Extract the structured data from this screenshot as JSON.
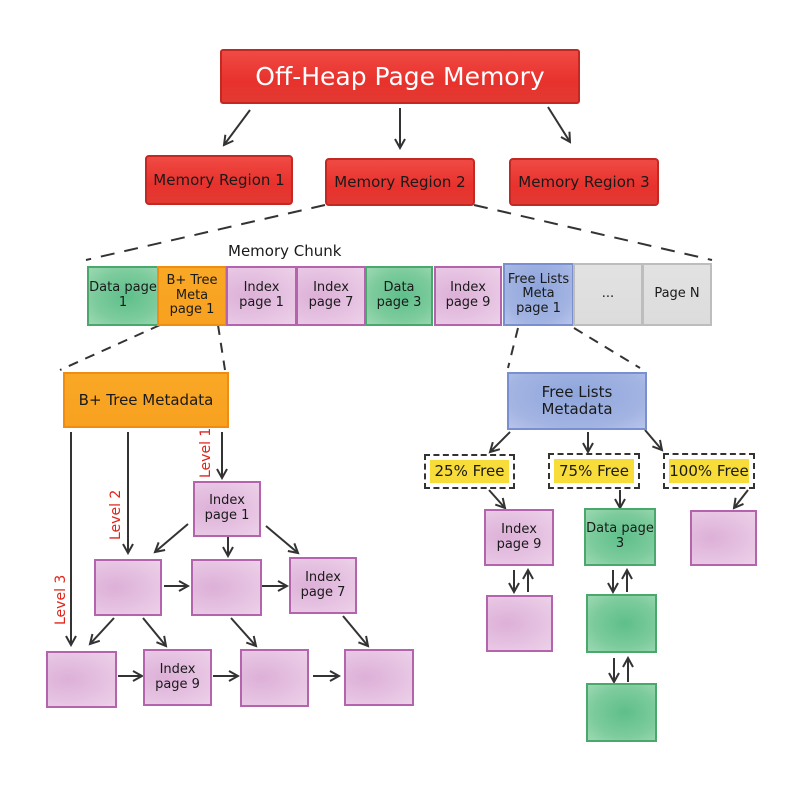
{
  "title": "Off-Heap Page Memory",
  "regions": [
    "Memory Region 1",
    "Memory Region 2",
    "Memory Region 3"
  ],
  "chunk": {
    "title": "Memory Chunk",
    "cells": [
      {
        "label": "Data page 1",
        "kind": "data"
      },
      {
        "label": "B+ Tree Meta page 1",
        "kind": "btree-meta"
      },
      {
        "label": "Index page 1",
        "kind": "index"
      },
      {
        "label": "Index page 7",
        "kind": "index"
      },
      {
        "label": "Data page 3",
        "kind": "data"
      },
      {
        "label": "Index page 9",
        "kind": "index"
      },
      {
        "label": "Free Lists Meta page 1",
        "kind": "freelist-meta"
      },
      {
        "label": "...",
        "kind": "empty"
      },
      {
        "label": "Page N",
        "kind": "empty"
      }
    ]
  },
  "btree": {
    "meta_label": "B+ Tree Metadata",
    "levels": [
      "Level 1",
      "Level 2",
      "Level 3"
    ],
    "level1": [
      "Index page 1"
    ],
    "level2": [
      "",
      "",
      "Index page 7"
    ],
    "level3": [
      "",
      "Index page 9",
      "",
      ""
    ]
  },
  "freelists": {
    "meta_label": "Free Lists Metadata",
    "buckets": [
      {
        "label": "25% Free",
        "pages": [
          {
            "label": "Index page 9",
            "kind": "index"
          },
          {
            "label": "",
            "kind": "index"
          }
        ]
      },
      {
        "label": "75% Free",
        "pages": [
          {
            "label": "Data page 3",
            "kind": "data"
          },
          {
            "label": "",
            "kind": "data"
          },
          {
            "label": "",
            "kind": "data"
          }
        ]
      },
      {
        "label": "100% Free",
        "pages": [
          {
            "label": "",
            "kind": "index"
          }
        ]
      }
    ]
  },
  "colors": {
    "region": "#e8312c",
    "data_page": "#7ccb9c",
    "index_page": "#e6c3e2",
    "btree_meta": "#f7a11f",
    "freelist_meta": "#a3b4e2",
    "free_bucket": "#f8dc3a",
    "level_label": "#e0241b"
  }
}
